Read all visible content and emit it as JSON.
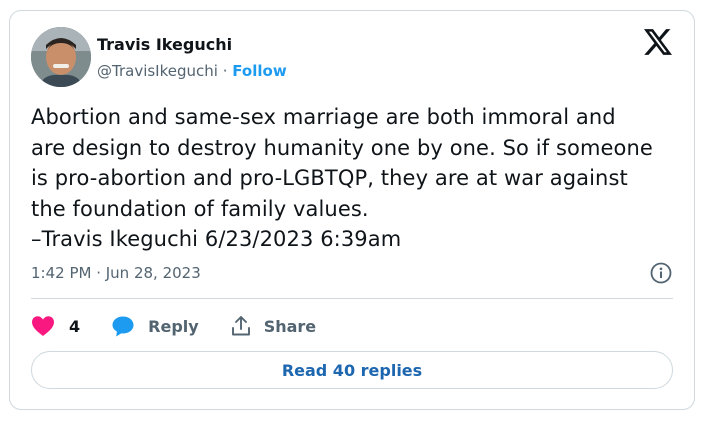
{
  "author": {
    "name": "Travis Ikeguchi",
    "handle": "@TravisIkeguchi",
    "separator": "·",
    "follow_label": "Follow"
  },
  "tweet": {
    "text": "Abortion and same-sex marriage are both immoral and\nare design to destroy humanity one by one. So if someone\nis pro-abortion and pro-LGBTQP, they are at war against\nthe foundation of family values.\n–Travis Ikeguchi 6/23/2023 6:39am"
  },
  "meta": {
    "timestamp": "1:42 PM · Jun 28, 2023"
  },
  "actions": {
    "like_count": "4",
    "reply_label": "Reply",
    "share_label": "Share"
  },
  "read_replies_label": "Read 40 replies",
  "icons": {
    "logo": "x-logo-icon",
    "info": "info-icon",
    "like": "heart-icon",
    "reply": "reply-bubble-icon",
    "share": "share-icon"
  },
  "colors": {
    "accent": "#1d9bf0",
    "like": "#f91880",
    "muted": "#536471",
    "border": "#cfd9de"
  }
}
